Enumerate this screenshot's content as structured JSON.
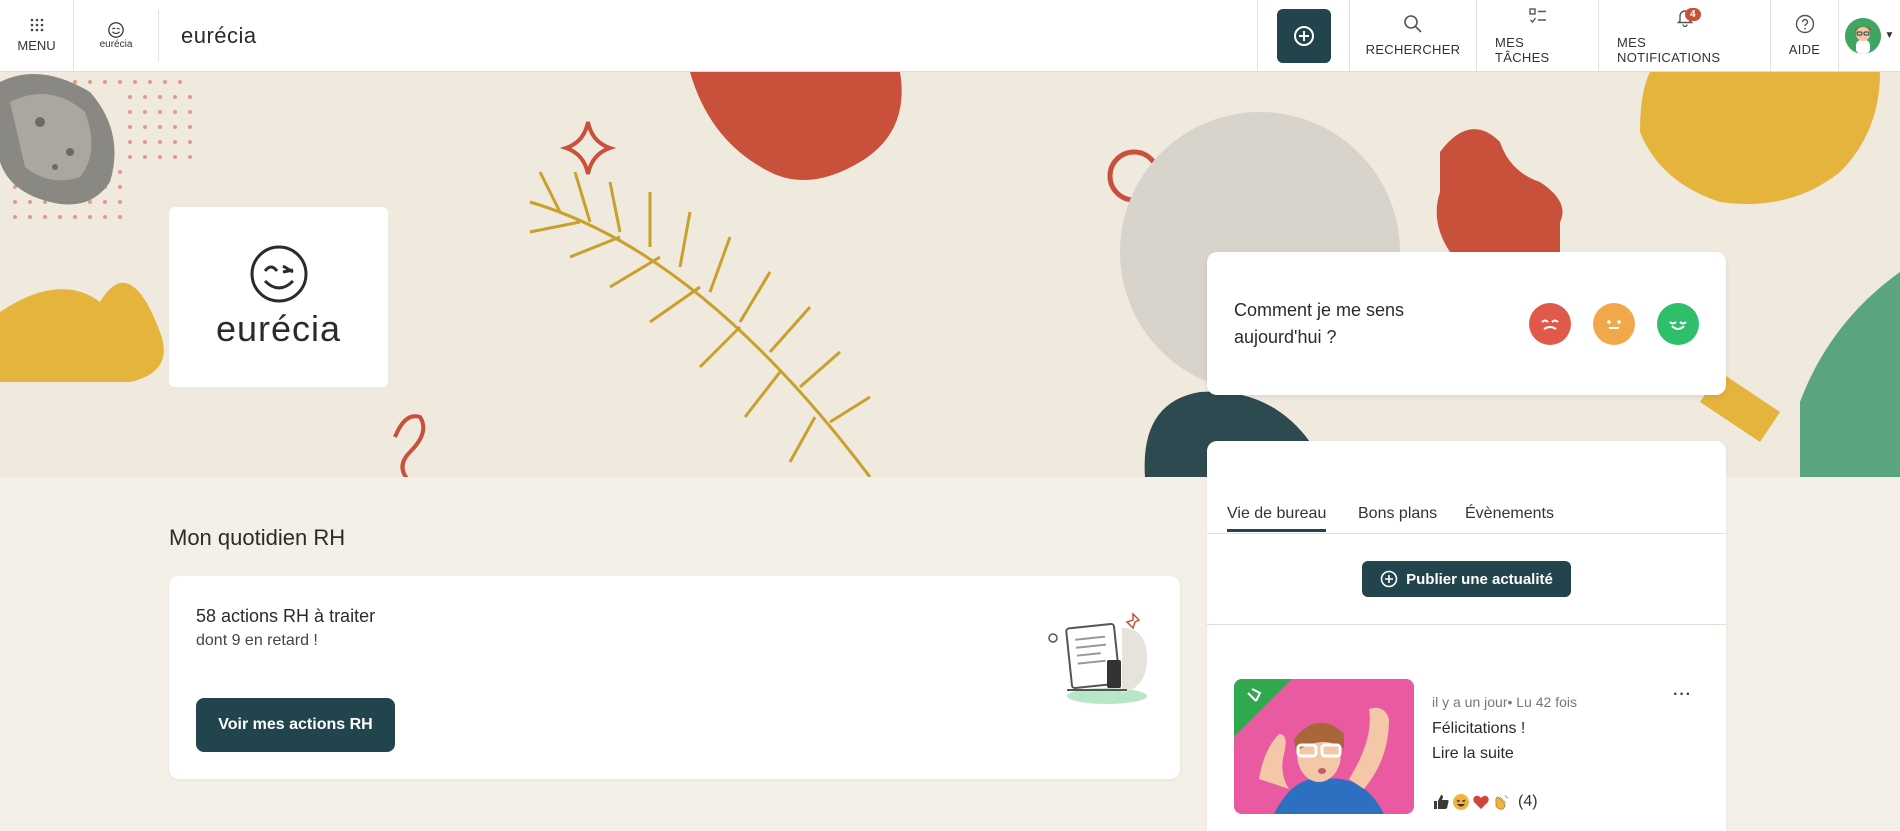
{
  "topbar": {
    "menu_label": "MENU",
    "logo_small_text": "eurécia",
    "brand": "eurécia",
    "search_label": "RECHERCHER",
    "tasks_label": "MES TÂCHES",
    "notifications_label": "MES NOTIFICATIONS",
    "notifications_count": "4",
    "help_label": "AIDE"
  },
  "hero": {
    "logo_word": "eurécia"
  },
  "mood": {
    "question": "Comment je me sens aujourd'hui ?",
    "options": [
      "bad",
      "neutral",
      "good"
    ]
  },
  "section": {
    "title": "Mon quotidien RH"
  },
  "rh_card": {
    "title": "58 actions RH à traiter",
    "subtitle": "dont 9 en retard !",
    "button": "Voir mes actions RH"
  },
  "news": {
    "tabs": [
      "Vie de bureau",
      "Bons plans",
      "Évènements"
    ],
    "active_tab": 0,
    "publish_button": "Publier une actualité",
    "post": {
      "meta": "il y a un jour• Lu 42 fois",
      "title": "Félicitations !",
      "link": "Lire la suite",
      "more": "···",
      "reactions_count": "(4)"
    }
  },
  "colors": {
    "primary": "#22444d",
    "badge": "#c9503b",
    "background": "#f4efe7"
  }
}
